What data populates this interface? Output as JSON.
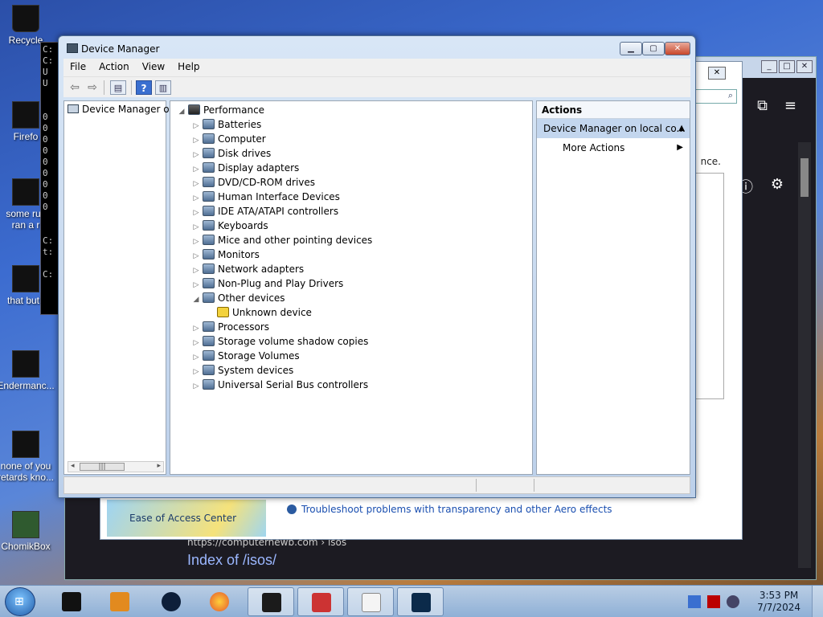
{
  "desktop": {
    "icons": [
      {
        "label": "Recycle"
      },
      {
        "label": "Firefo"
      },
      {
        "label": "some rus",
        "label2": "ran a r"
      },
      {
        "label": "that but i"
      },
      {
        "label": "Endermanc..."
      },
      {
        "label": "none of you",
        "label2": "retards kno..."
      },
      {
        "label": "ChomikBox"
      }
    ]
  },
  "background": {
    "cmd_lines": [
      "C:",
      "C:",
      "U",
      "U",
      "",
      "",
      "0",
      "0",
      "0",
      "0",
      "0",
      "0",
      "0",
      "0",
      "0",
      "",
      "",
      "C:",
      "t:",
      "",
      "C:"
    ],
    "control_panel": {
      "ease_of_access": "Ease of Access Center",
      "troubleshoot_link": "Troubleshoot problems with transparency and other Aero effects",
      "snippet": "nce."
    },
    "browser": {
      "url_line": "https://computernewb.com › isos",
      "index_title": "Index of /isos/"
    }
  },
  "window": {
    "title": "Device Manager",
    "menu": [
      "File",
      "Action",
      "View",
      "Help"
    ],
    "left_pane_node": "Device Manager or",
    "tree_root": "Performance",
    "tree": [
      {
        "label": "Batteries",
        "level": 1,
        "expanded": false
      },
      {
        "label": "Computer",
        "level": 1,
        "expanded": false
      },
      {
        "label": "Disk drives",
        "level": 1,
        "expanded": false
      },
      {
        "label": "Display adapters",
        "level": 1,
        "expanded": false
      },
      {
        "label": "DVD/CD-ROM drives",
        "level": 1,
        "expanded": false
      },
      {
        "label": "Human Interface Devices",
        "level": 1,
        "expanded": false
      },
      {
        "label": "IDE ATA/ATAPI controllers",
        "level": 1,
        "expanded": false
      },
      {
        "label": "Keyboards",
        "level": 1,
        "expanded": false
      },
      {
        "label": "Mice and other pointing devices",
        "level": 1,
        "expanded": false
      },
      {
        "label": "Monitors",
        "level": 1,
        "expanded": false
      },
      {
        "label": "Network adapters",
        "level": 1,
        "expanded": false
      },
      {
        "label": "Non-Plug and Play Drivers",
        "level": 1,
        "expanded": false
      },
      {
        "label": "Other devices",
        "level": 1,
        "expanded": true
      },
      {
        "label": "Unknown device",
        "level": 2,
        "warning": true
      },
      {
        "label": "Processors",
        "level": 1,
        "expanded": false
      },
      {
        "label": "Storage volume shadow copies",
        "level": 1,
        "expanded": false
      },
      {
        "label": "Storage Volumes",
        "level": 1,
        "expanded": false
      },
      {
        "label": "System devices",
        "level": 1,
        "expanded": false
      },
      {
        "label": "Universal Serial Bus controllers",
        "level": 1,
        "expanded": false
      }
    ],
    "actions": {
      "header": "Actions",
      "selected": "Device Manager on local co...",
      "more": "More Actions"
    }
  },
  "taskbar": {
    "time": "3:53 PM",
    "date": "7/7/2024"
  },
  "colors": {
    "selection": "#c3d6ee",
    "title_close": "#c8462a",
    "taskbar": "#8fb0d6"
  }
}
